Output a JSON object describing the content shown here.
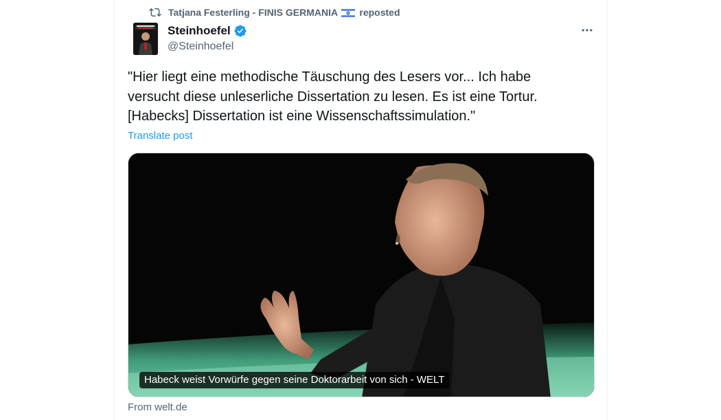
{
  "repost": {
    "reposter_name": "Tatjana Festerling - FINIS GERMANIA",
    "reposted_label": "reposted",
    "icon": "repost-icon",
    "flag_icon": "israel-flag-icon"
  },
  "author": {
    "display_name": "Steinhoefel",
    "handle": "@Steinhoefel",
    "verified": true,
    "verified_color": "#1d9bf0"
  },
  "tweet": {
    "text": "\"Hier liegt eine methodische Täuschung des Lesers vor... Ich habe\nversucht diese unleserliche Dissertation zu lesen. Es ist eine Tortur.\n[Habecks] Dissertation ist eine Wissenschaftssimulation.\"",
    "translate_label": "Translate post"
  },
  "media": {
    "caption": "Habeck weist Vorwürfe gegen seine Doktorarbeit von sich - WELT",
    "source": "From welt.de"
  },
  "colors": {
    "link": "#1d9bf0",
    "secondary_text": "#536471",
    "primary_text": "#0f1419"
  }
}
